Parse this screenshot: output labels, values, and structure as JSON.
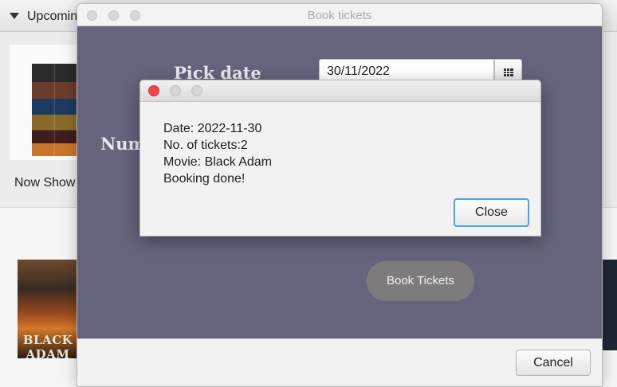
{
  "background": {
    "upcoming_label": "Upcomin",
    "now_showing_label": "Now Show",
    "poster_title": "BLACK ADAM"
  },
  "book_window": {
    "title": "Book tickets",
    "pick_date_label": "Pick date",
    "number_label": "Num",
    "date_value": "30/11/2022",
    "book_button_label": "Book Tickets",
    "cancel_button_label": "Cancel",
    "icons": {
      "calendar": "calendar-icon"
    }
  },
  "dialog": {
    "lines": [
      "Date: 2022-11-30",
      "No. of tickets:2",
      "Movie: Black Adam",
      "Booking done!"
    ],
    "close_button_label": "Close"
  },
  "colors": {
    "content_background": "#66637d",
    "close_traffic_light": "#f0454a",
    "focus_ring": "#4aa3e0",
    "book_button": "#7d7b7b"
  }
}
